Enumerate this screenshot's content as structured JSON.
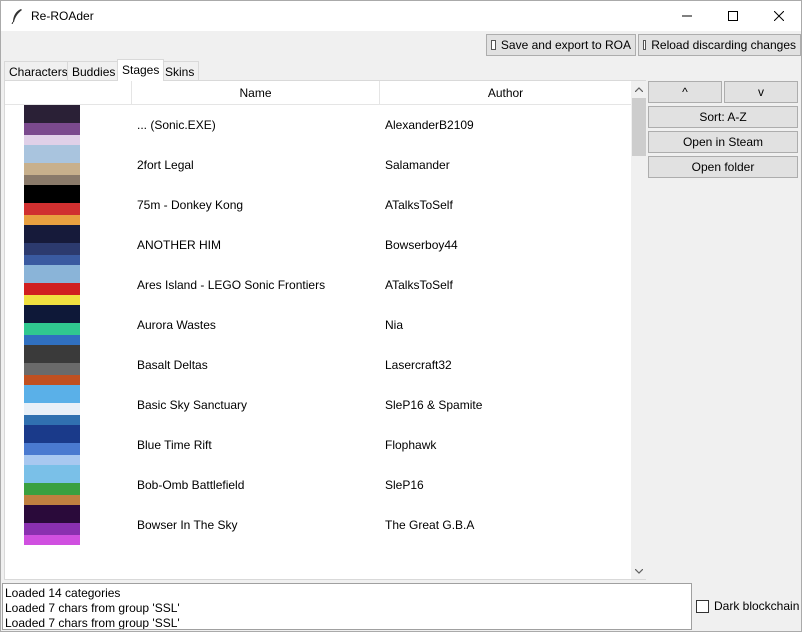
{
  "window": {
    "title": "Re-ROAder"
  },
  "toolbar": {
    "save_export_label": "Save and export to ROA",
    "reload_label": "Reload discarding changes"
  },
  "tabs": [
    {
      "label": "Characters",
      "active": false
    },
    {
      "label": "Buddies",
      "active": false
    },
    {
      "label": "Stages",
      "active": true
    },
    {
      "label": "Skins",
      "active": false
    }
  ],
  "table": {
    "columns": [
      "Name",
      "Author"
    ],
    "rows": [
      {
        "name": "... (Sonic.EXE)",
        "author": "AlexanderB2109",
        "thumb_colors": [
          "#2a2036",
          "#7b4a8e",
          "#e0d0e8"
        ]
      },
      {
        "name": "2fort Legal",
        "author": "Salamander",
        "thumb_colors": [
          "#a9c4de",
          "#c8b08c",
          "#8a7a6a"
        ]
      },
      {
        "name": "75m - Donkey Kong",
        "author": "ATalksToSelf",
        "thumb_colors": [
          "#000000",
          "#d03030",
          "#e8a040"
        ]
      },
      {
        "name": "ANOTHER HIM",
        "author": "Bowserboy44",
        "thumb_colors": [
          "#161a3a",
          "#2c3a6e",
          "#3a5aa0"
        ]
      },
      {
        "name": "Ares Island - LEGO Sonic Frontiers",
        "author": "ATalksToSelf",
        "thumb_colors": [
          "#8ab4d8",
          "#d02020",
          "#f0e040"
        ]
      },
      {
        "name": "Aurora Wastes",
        "author": "Nia",
        "thumb_colors": [
          "#0e1838",
          "#30c890",
          "#3070c0"
        ]
      },
      {
        "name": "Basalt Deltas",
        "author": "Lasercraft32",
        "thumb_colors": [
          "#3a3a3a",
          "#6a6a6a",
          "#c05020"
        ]
      },
      {
        "name": "Basic Sky Sanctuary",
        "author": "SleP16 & Spamite",
        "thumb_colors": [
          "#5ab0e8",
          "#e8f0f8",
          "#3070b0"
        ]
      },
      {
        "name": "Blue Time Rift",
        "author": "Flophawk",
        "thumb_colors": [
          "#1a3a8a",
          "#4a7ad0",
          "#a8c8f0"
        ]
      },
      {
        "name": "Bob-Omb Battlefield",
        "author": "SleP16",
        "thumb_colors": [
          "#7ac0e8",
          "#3aa040",
          "#c08040"
        ]
      },
      {
        "name": "Bowser In The Sky",
        "author": "The Great G.B.A",
        "thumb_colors": [
          "#2a0a3a",
          "#8a30b0",
          "#d050e0"
        ]
      }
    ]
  },
  "side_buttons": {
    "up_label": "^",
    "down_label": "v",
    "sort_label": "Sort: A-Z",
    "steam_label": "Open in Steam",
    "folder_label": "Open folder"
  },
  "log": {
    "lines": [
      "Loaded 14 categories",
      "Loaded 7 chars from group 'SSL'",
      "Loaded 7 chars from group 'SSL'"
    ]
  },
  "dark_mode": {
    "label": "Dark blockchain",
    "checked": false
  }
}
